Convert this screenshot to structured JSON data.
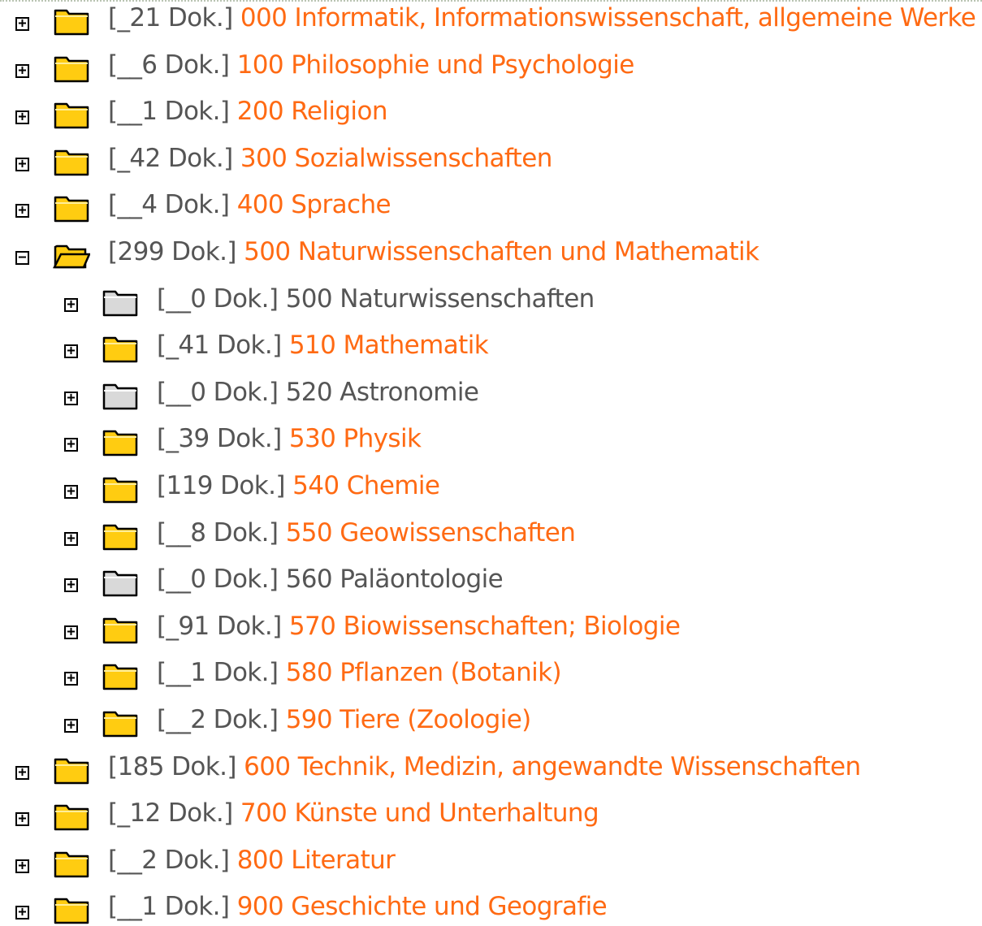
{
  "colors": {
    "link": "#ff6a13",
    "empty_text": "#555555",
    "count_text": "#555555",
    "folder_fill": "#ffcc11",
    "folder_empty_fill": "#d9d9d9",
    "folder_outline": "#000000"
  },
  "tree": {
    "items": [
      {
        "toggle": "+",
        "icon": "folder-closed-icon",
        "count": "[_21 Dok.]",
        "label": "000 Informatik, Informationswissenschaft, allgemeine Werke",
        "empty": false,
        "level": 0
      },
      {
        "toggle": "+",
        "icon": "folder-closed-icon",
        "count": "[__6 Dok.]",
        "label": "100 Philosophie und Psychologie",
        "empty": false,
        "level": 0
      },
      {
        "toggle": "+",
        "icon": "folder-closed-icon",
        "count": "[__1 Dok.]",
        "label": "200 Religion",
        "empty": false,
        "level": 0
      },
      {
        "toggle": "+",
        "icon": "folder-closed-icon",
        "count": "[_42 Dok.]",
        "label": "300 Sozialwissenschaften",
        "empty": false,
        "level": 0
      },
      {
        "toggle": "+",
        "icon": "folder-closed-icon",
        "count": "[__4 Dok.]",
        "label": "400 Sprache",
        "empty": false,
        "level": 0
      },
      {
        "toggle": "−",
        "icon": "folder-open-icon",
        "count": "[299 Dok.]",
        "label": "500 Naturwissenschaften und Mathematik",
        "empty": false,
        "level": 0
      },
      {
        "toggle": "+",
        "icon": "folder-closed-icon",
        "count": "[__0 Dok.]",
        "label": "500 Naturwissenschaften",
        "empty": true,
        "level": 1
      },
      {
        "toggle": "+",
        "icon": "folder-closed-icon",
        "count": "[_41 Dok.]",
        "label": "510 Mathematik",
        "empty": false,
        "level": 1
      },
      {
        "toggle": "+",
        "icon": "folder-closed-icon",
        "count": "[__0 Dok.]",
        "label": "520 Astronomie",
        "empty": true,
        "level": 1
      },
      {
        "toggle": "+",
        "icon": "folder-closed-icon",
        "count": "[_39 Dok.]",
        "label": "530 Physik",
        "empty": false,
        "level": 1
      },
      {
        "toggle": "+",
        "icon": "folder-closed-icon",
        "count": "[119 Dok.]",
        "label": "540 Chemie",
        "empty": false,
        "level": 1
      },
      {
        "toggle": "+",
        "icon": "folder-closed-icon",
        "count": "[__8 Dok.]",
        "label": "550 Geowissenschaften",
        "empty": false,
        "level": 1
      },
      {
        "toggle": "+",
        "icon": "folder-closed-icon",
        "count": "[__0 Dok.]",
        "label": "560 Paläontologie",
        "empty": true,
        "level": 1
      },
      {
        "toggle": "+",
        "icon": "folder-closed-icon",
        "count": "[_91 Dok.]",
        "label": "570 Biowissenschaften; Biologie",
        "empty": false,
        "level": 1
      },
      {
        "toggle": "+",
        "icon": "folder-closed-icon",
        "count": "[__1 Dok.]",
        "label": "580 Pflanzen (Botanik)",
        "empty": false,
        "level": 1
      },
      {
        "toggle": "+",
        "icon": "folder-closed-icon",
        "count": "[__2 Dok.]",
        "label": "590 Tiere (Zoologie)",
        "empty": false,
        "level": 1
      },
      {
        "toggle": "+",
        "icon": "folder-closed-icon",
        "count": "[185 Dok.]",
        "label": "600 Technik, Medizin, angewandte Wissenschaften",
        "empty": false,
        "level": 0
      },
      {
        "toggle": "+",
        "icon": "folder-closed-icon",
        "count": "[_12 Dok.]",
        "label": "700 Künste und Unterhaltung",
        "empty": false,
        "level": 0
      },
      {
        "toggle": "+",
        "icon": "folder-closed-icon",
        "count": "[__2 Dok.]",
        "label": "800 Literatur",
        "empty": false,
        "level": 0
      },
      {
        "toggle": "+",
        "icon": "folder-closed-icon",
        "count": "[__1 Dok.]",
        "label": "900 Geschichte und Geografie",
        "empty": false,
        "level": 0
      }
    ]
  }
}
